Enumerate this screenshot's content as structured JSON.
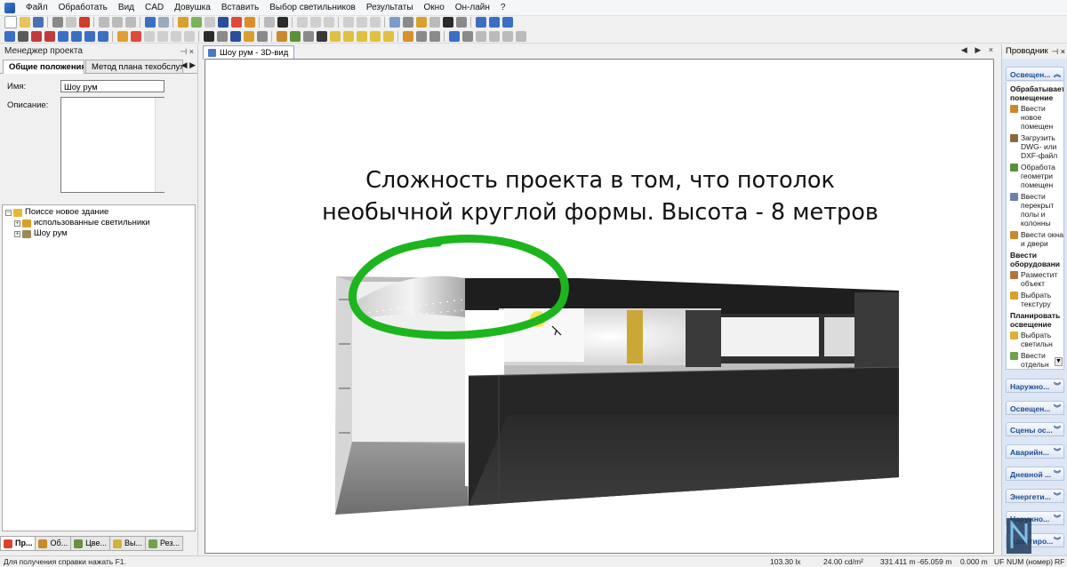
{
  "menu": [
    "Файл",
    "Обработать",
    "Вид",
    "CAD",
    "Довушка",
    "Вставить",
    "Выбор светильников",
    "Результаты",
    "Окно",
    "Он-лайн",
    "?"
  ],
  "left_panel": {
    "title": "Менеджер проекта",
    "pin": "⊣ ×",
    "tabs": [
      "Общие положения",
      "Метод плана техобслуживани"
    ],
    "tab_arrows": "◀ ▶",
    "name_label": "Имя:",
    "name_value": "Шоу рум",
    "description_label": "Описание:",
    "description_value": "",
    "tree": [
      {
        "label": "Поиссе новое здание",
        "level": 0,
        "expander": "−",
        "icon_color": "#e8b63b"
      },
      {
        "label": "использованные светильники",
        "level": 1,
        "expander": "+",
        "icon_color": "#d9a12b"
      },
      {
        "label": "Шоу рум",
        "level": 1,
        "expander": "+",
        "icon_color": "#a0875a"
      }
    ],
    "bottom_tabs": [
      {
        "label": "Пр...",
        "icon_color": "#d9452b",
        "active": true
      },
      {
        "label": "Об...",
        "icon_color": "#c98a2b",
        "active": false
      },
      {
        "label": "Цве...",
        "icon_color": "#6b8f3b",
        "active": false
      },
      {
        "label": "Вы...",
        "icon_color": "#d1b23a",
        "active": false
      },
      {
        "label": "Рез...",
        "icon_color": "#6fa24a",
        "active": false
      }
    ]
  },
  "document": {
    "tab_label": "Шоу рум - 3D-вид",
    "window_controls": "◀ ▶ ×",
    "caption_lines": [
      "Сложность проекта в том, что потолок",
      "необычной круглой формы. Высота - 8 метров"
    ],
    "highlight_color": "#1db51d"
  },
  "explorer": {
    "title": "Проводник",
    "pin": "⊣ ×",
    "active_section": "Освещен...",
    "groups": [
      {
        "title": "Обрабатывает помещение",
        "items": [
          {
            "label": "Ввести новое помещен",
            "icon_color": "#c98a2b"
          },
          {
            "label": "Загрузить DWG- или DXF-файл",
            "icon_color": "#8a6a3b"
          },
          {
            "label": "Обработа геометри помещен",
            "icon_color": "#5a8f3b"
          },
          {
            "label": "Ввести перекрыт полы и колонны",
            "icon_color": "#6b7fb0"
          },
          {
            "label": "Ввести окна и двери",
            "icon_color": "#c98a2b"
          }
        ]
      },
      {
        "title": "Ввести оборудовани",
        "items": [
          {
            "label": "Разместит объект",
            "icon_color": "#b0763b"
          },
          {
            "label": "Выбрать текстуру",
            "icon_color": "#d9a12b"
          }
        ]
      },
      {
        "title": "Планировать освещение",
        "items": [
          {
            "label": "Выбрать светильн",
            "icon_color": "#e0b030"
          },
          {
            "label": "Ввести отдельн",
            "icon_color": "#6fa24a"
          }
        ]
      }
    ],
    "sections": [
      "Наружно...",
      "Освещен...",
      "Сцены ос...",
      "Аварийн...",
      "Дневной ...",
      "Энергети...",
      "Наружно...",
      "Адаптиро..."
    ]
  },
  "status": {
    "help": "Для получения справки нажать F1.",
    "illuminance": "103.30 lx",
    "luminance": "24.00 cd/m²",
    "x": "331.411 m",
    "y": "-65.059 m",
    "z": "0.000 m",
    "uf": "UF",
    "num": "NUM (номер)",
    "rf": "RF"
  }
}
